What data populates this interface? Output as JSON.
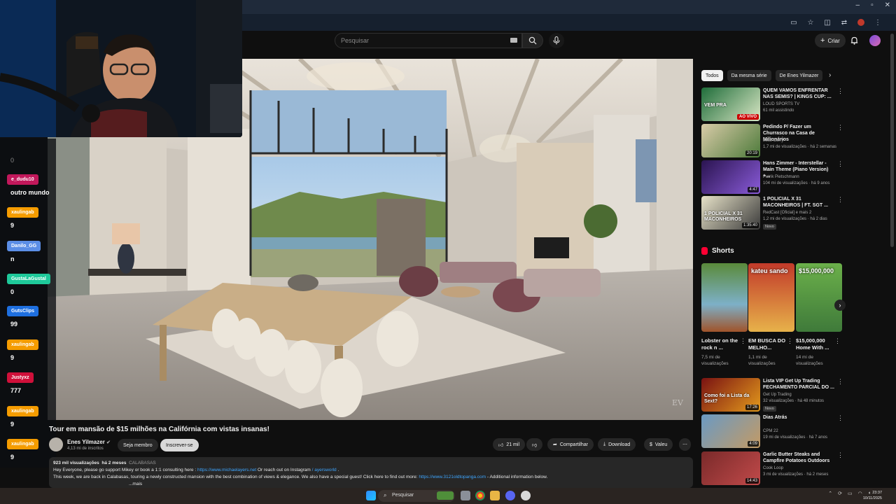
{
  "browser": {
    "controls": [
      "–",
      "▫",
      "✕"
    ]
  },
  "yt_header": {
    "search_placeholder": "Pesquisar",
    "create_label": "Criar"
  },
  "video": {
    "title": "Tour em mansão de $15 milhões na Califórnia com vistas insanas!",
    "watermark": "EV",
    "channel": {
      "name": "Enes Yilmazer",
      "subscribers": "4,13 mi de inscritos",
      "join_label": "Seja membro",
      "subscribe_label": "Inscrever-se"
    },
    "actions": {
      "likes": "21 mil",
      "share": "Compartilhar",
      "download": "Download",
      "thanks": "Valeu"
    },
    "description": {
      "views": "923 mil visualizações",
      "age": "há 2 meses",
      "tags": "CALABASAS",
      "line1_a": "Hey Everyone, please go support Mikey or book a 1:1 consulting here : ",
      "line1_link1": "https://www.michaelayers.net",
      "line1_b": " Or reach out on Instagram ",
      "line1_link2": "/ ayersworld",
      "line1_c": " .",
      "line2_a": "This week, we are back in Calabasas, touring a newly constructed mansion with the best combination of views & elegance. We also have a special guest! Click here to find out more: ",
      "line2_link": "https://www.3121oldtopanga.com",
      "line2_b": " - Additional information below.",
      "more": "...mais"
    }
  },
  "chat": {
    "top_value": "0",
    "messages": [
      {
        "user": "e_dudu10",
        "text": "outro mundo",
        "color": "#c2185b"
      },
      {
        "user": "xaulingab",
        "text": "9",
        "color": "#f59c00"
      },
      {
        "user": "Danilo_GG",
        "text": "n",
        "color": "#5b8ee6"
      },
      {
        "user": "GustaLaGustal",
        "text": "0",
        "color": "#1ec99a"
      },
      {
        "user": "GutsClips",
        "text": "99",
        "color": "#1e6fe0"
      },
      {
        "user": "xaulingab",
        "text": "9",
        "color": "#f59c00"
      },
      {
        "user": "Justyxz",
        "text": "777",
        "color": "#d0103a"
      },
      {
        "user": "xaulingab",
        "text": "9",
        "color": "#f59c00"
      },
      {
        "user": "xaulingab",
        "text": "9",
        "color": "#f59c00"
      }
    ]
  },
  "sidebar": {
    "chips": [
      "Todos",
      "Da mesma série",
      "De Enes Yilmazer"
    ],
    "recs_top": [
      {
        "title": "QUEM VAMOS ENFRENTAR NAS SEMIS? | KINGS CUP: ...",
        "channel": "LOUD SPORTS TV",
        "meta": "61 mil assistindo",
        "duration": "",
        "badge": "",
        "live": "AO VIVO",
        "thumb_text": "VEM PRA"
      },
      {
        "title": "Pedindo P/ Fazer um Churrasco na Casa de Milionários",
        "channel": "Joao Curry",
        "meta": "1,7 mi de visualizações · há 2 semanas",
        "duration": "20:19",
        "badge": "",
        "live": "",
        "thumb_text": ""
      },
      {
        "title": "Hans Zimmer - Interstellar - Main Theme (Piano Version) +...",
        "channel": "Patrik Pietschmann",
        "meta": "104 mi de visualizações · há 9 anos",
        "duration": "4:47",
        "badge": "",
        "live": "",
        "thumb_text": ""
      },
      {
        "title": "1 POLICIAL X 31 MACONHEIROS | FT. SGT ...",
        "channel": "RedCast [Oficial] e mais 2",
        "meta": "1,2 mi de visualizações · há 2 dias",
        "duration": "1:35:40",
        "badge": "Novo",
        "live": "",
        "thumb_text": "1 POLICIAL X 31 MACONHEIROS"
      }
    ],
    "shorts_title": "Shorts",
    "shorts": [
      {
        "title": "Lobster on the rock n ...",
        "views": "7,5 mi de visualizações",
        "thumb_text": ""
      },
      {
        "title": "EM BUSCA DO MELHO...",
        "views": "1,1 mi de visualizações",
        "thumb_text": "kateu sando"
      },
      {
        "title": "$15,000,000 Home With ...",
        "views": "14 mi de visualizações",
        "thumb_text": "$15,000,000"
      }
    ],
    "recs_bottom": [
      {
        "title": "Lista VIP Get Up Trading FECHAMENTO PARCIAL DO ...",
        "channel": "Get Up Trading",
        "meta": "32 visualizações · há 48 minutos",
        "duration": "17:26",
        "badge": "Novo",
        "thumb_text": "Como foi a Lista da Sext?"
      },
      {
        "title": "Dias Atrás",
        "channel": "CPM 22",
        "meta": "19 mi de visualizações · há 7 anos",
        "duration": "4:09",
        "badge": ""
      },
      {
        "title": "Garlic Butter Steaks and Campfire Potatoes Outdoors",
        "channel": "Cook Loop",
        "meta": "3 mi de visualizações · há 2 meses",
        "duration": "14:43",
        "badge": ""
      }
    ]
  },
  "taskbar": {
    "search_label": "Pesquisar",
    "time": "23:37",
    "date": "10/11/2025"
  }
}
